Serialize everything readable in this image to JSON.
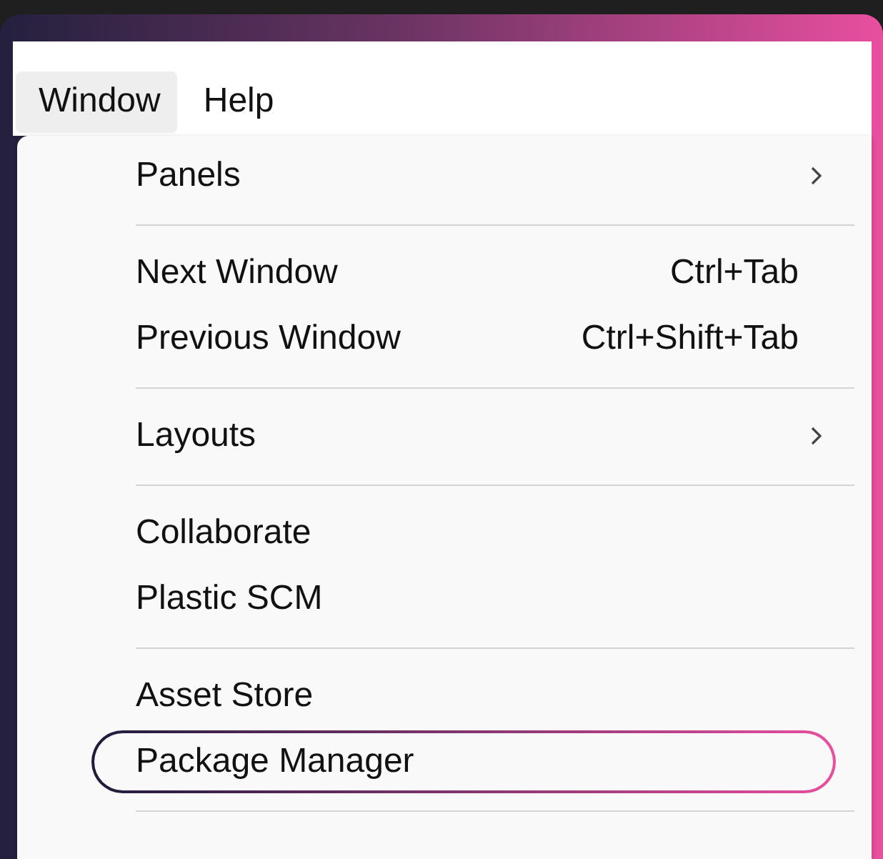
{
  "menubar": [
    {
      "label": "Window",
      "selected": true
    },
    {
      "label": "Help",
      "selected": false
    }
  ],
  "menu": {
    "items": [
      {
        "kind": "item",
        "label": "Panels",
        "submenu": true,
        "highlighted": false
      },
      {
        "kind": "separator"
      },
      {
        "kind": "item",
        "label": "Next Window",
        "shortcut": "Ctrl+Tab",
        "submenu": false,
        "highlighted": false
      },
      {
        "kind": "item",
        "label": "Previous Window",
        "shortcut": "Ctrl+Shift+Tab",
        "submenu": false,
        "highlighted": false
      },
      {
        "kind": "separator"
      },
      {
        "kind": "item",
        "label": "Layouts",
        "submenu": true,
        "highlighted": false
      },
      {
        "kind": "separator"
      },
      {
        "kind": "item",
        "label": "Collaborate",
        "submenu": false,
        "highlighted": false
      },
      {
        "kind": "item",
        "label": "Plastic SCM",
        "submenu": false,
        "highlighted": false
      },
      {
        "kind": "separator"
      },
      {
        "kind": "item",
        "label": "Asset Store",
        "submenu": false,
        "highlighted": false
      },
      {
        "kind": "item",
        "label": "Package Manager",
        "submenu": false,
        "highlighted": true
      },
      {
        "kind": "separator"
      }
    ]
  }
}
